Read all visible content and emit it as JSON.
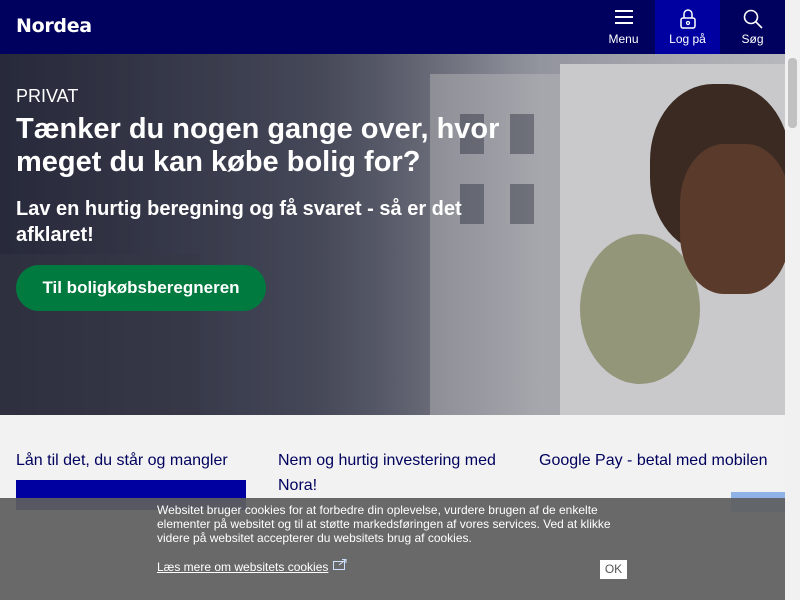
{
  "header": {
    "logo": "Nordea",
    "menu_label": "Menu",
    "login_label": "Log på",
    "search_label": "Søg"
  },
  "hero": {
    "eyebrow": "PRIVAT",
    "title": "Tænker du nogen gange over, hvor meget du kan købe bolig for?",
    "subtitle": "Lav en hurtig beregning og få svaret - så er det afklaret!",
    "cta_label": "Til boligkøbsberegneren"
  },
  "cards": [
    {
      "title": "Lån til det, du står og mangler"
    },
    {
      "title": "Nem og hurtig investering med Nora!"
    },
    {
      "title": "Google Pay - betal med mobilen"
    }
  ],
  "cookie_banner": {
    "text": "Websitet bruger cookies for at forbedre din oplevelse, vurdere brugen af de enkelte elementer på websitet og til at støtte markedsføringen af vores services. Ved at klikke videre på websitet accepterer du websitets brug af cookies.",
    "link_label": "Læs mere om websitets cookies",
    "ok_label": "OK"
  },
  "colors": {
    "brand_navy": "#00005e",
    "brand_blue": "#0000a0",
    "cta_green": "#007a3e"
  }
}
